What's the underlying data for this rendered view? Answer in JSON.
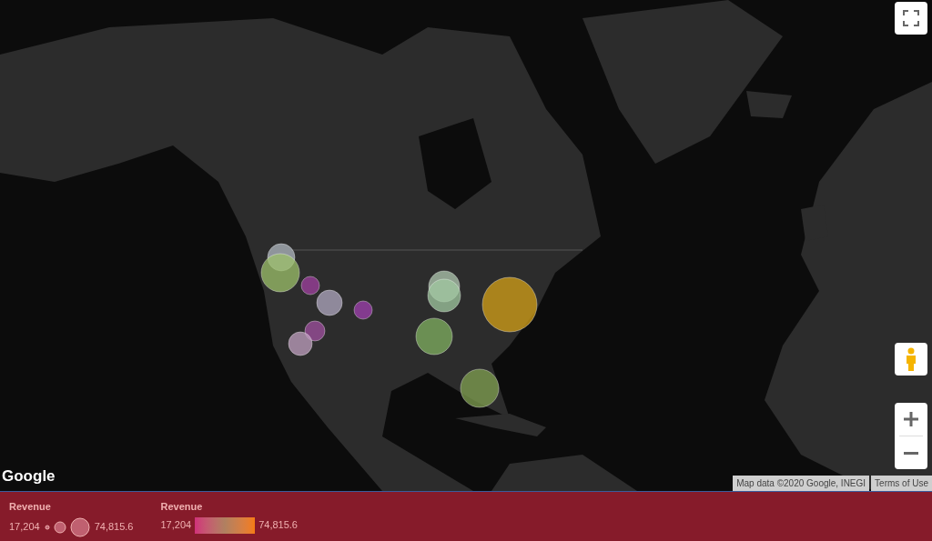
{
  "map": {
    "logo": "Google",
    "attribution": "Map data ©2020 Google, INEGI",
    "terms_link": "Terms of Use"
  },
  "legends": [
    {
      "kind": "size",
      "title": "Revenue",
      "min": "17,204",
      "max": "74,815.6"
    },
    {
      "kind": "gradient",
      "title": "Revenue",
      "min": "17,204",
      "max": "74,815.6"
    }
  ]
}
